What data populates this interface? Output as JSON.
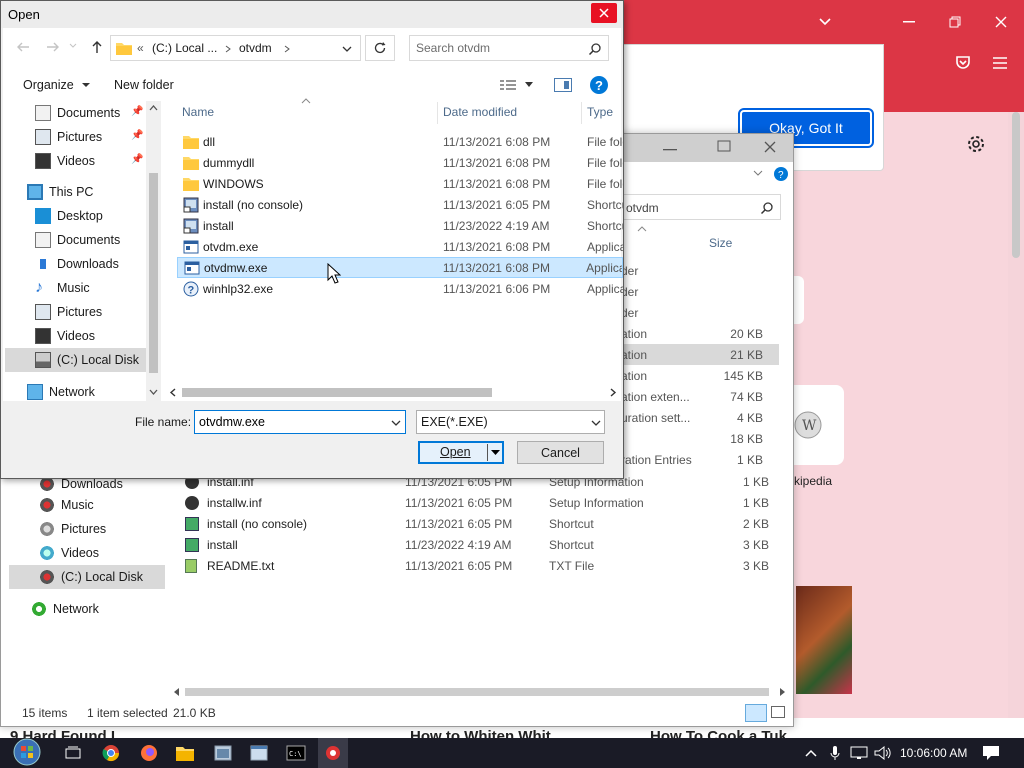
{
  "browser": {
    "popup_button": "Okay, Got It",
    "wiki_label": "kipedia",
    "story_titles": [
      "9 Hard Found I",
      "How to Whiten Whit",
      "How To Cook a Tuk"
    ]
  },
  "explorer": {
    "search_value": "otvdm",
    "col_size": "Size",
    "sidebar": [
      {
        "label": "Downloads"
      },
      {
        "label": "Music"
      },
      {
        "label": "Pictures"
      },
      {
        "label": "Videos"
      },
      {
        "label": "(C:) Local Disk"
      },
      {
        "label": "Network"
      }
    ],
    "right_fragments": [
      {
        "type": "der",
        "size": ""
      },
      {
        "type": "der",
        "size": ""
      },
      {
        "type": "der",
        "size": ""
      },
      {
        "type": "ation",
        "size": "20 KB"
      },
      {
        "type": "ation",
        "size": "21 KB"
      },
      {
        "type": "ation",
        "size": "145 KB"
      },
      {
        "type": "ation exten...",
        "size": "74 KB"
      },
      {
        "type": "uration sett...",
        "size": "4 KB"
      },
      {
        "type": "",
        "size": "18 KB"
      },
      {
        "type": "ration Entries",
        "size": "1 KB"
      }
    ],
    "rows": [
      {
        "name": "install.inf",
        "date": "11/13/2021 6:05 PM",
        "type": "Setup Information",
        "size": "1 KB"
      },
      {
        "name": "installw.inf",
        "date": "11/13/2021 6:05 PM",
        "type": "Setup Information",
        "size": "1 KB"
      },
      {
        "name": "install (no console)",
        "date": "11/13/2021 6:05 PM",
        "type": "Shortcut",
        "size": "2 KB"
      },
      {
        "name": "install",
        "date": "11/23/2022 4:19 AM",
        "type": "Shortcut",
        "size": "3 KB"
      },
      {
        "name": "README.txt",
        "date": "11/13/2021 6:05 PM",
        "type": "TXT File",
        "size": "3 KB"
      }
    ],
    "status": {
      "items": "15 items",
      "selected": "1 item selected",
      "size": "21.0 KB"
    }
  },
  "dialog": {
    "title": "Open",
    "address": {
      "prefix": "«",
      "crumb1": "(C:) Local ...",
      "crumb2": "otvdm"
    },
    "search_placeholder": "Search otvdm",
    "organize": "Organize",
    "new_folder": "New folder",
    "columns": {
      "name": "Name",
      "date": "Date modified",
      "type": "Type"
    },
    "tree": [
      {
        "label": "Documents",
        "pinned": true
      },
      {
        "label": "Pictures",
        "pinned": true
      },
      {
        "label": "Videos",
        "pinned": true
      },
      {
        "label": "This PC",
        "pinned": false
      },
      {
        "label": "Desktop",
        "pinned": false
      },
      {
        "label": "Documents",
        "pinned": false
      },
      {
        "label": "Downloads",
        "pinned": false
      },
      {
        "label": "Music",
        "pinned": false
      },
      {
        "label": "Pictures",
        "pinned": false
      },
      {
        "label": "Videos",
        "pinned": false
      },
      {
        "label": "(C:) Local Disk",
        "pinned": false
      },
      {
        "label": "Network",
        "pinned": false
      }
    ],
    "files": [
      {
        "name": "dll",
        "date": "11/13/2021 6:08 PM",
        "type": "File folder",
        "icon": "folder-icon"
      },
      {
        "name": "dummydll",
        "date": "11/13/2021 6:08 PM",
        "type": "File folder",
        "icon": "folder-icon"
      },
      {
        "name": "WINDOWS",
        "date": "11/13/2021 6:08 PM",
        "type": "File folder",
        "icon": "folder-icon"
      },
      {
        "name": "install (no console)",
        "date": "11/13/2021 6:05 PM",
        "type": "Shortcut",
        "icon": "shortcut-icon"
      },
      {
        "name": "install",
        "date": "11/23/2022 4:19 AM",
        "type": "Shortcut",
        "icon": "shortcut-icon"
      },
      {
        "name": "otvdm.exe",
        "date": "11/13/2021 6:08 PM",
        "type": "Application",
        "icon": "app-icon"
      },
      {
        "name": "otvdmw.exe",
        "date": "11/13/2021 6:08 PM",
        "type": "Application",
        "icon": "app-icon",
        "selected": true
      },
      {
        "name": "winhlp32.exe",
        "date": "11/13/2021 6:06 PM",
        "type": "Application",
        "icon": "help-icon"
      }
    ],
    "filename_label": "File name:",
    "filename_value": "otvdmw.exe",
    "filetype": "EXE(*.EXE)",
    "open_label": "Open",
    "cancel_label": "Cancel"
  },
  "taskbar": {
    "clock": "10:06:00 AM"
  },
  "colors": {
    "browser_red": "#dc3645",
    "accent_blue": "#0078d7",
    "selection": "#cce8ff"
  }
}
